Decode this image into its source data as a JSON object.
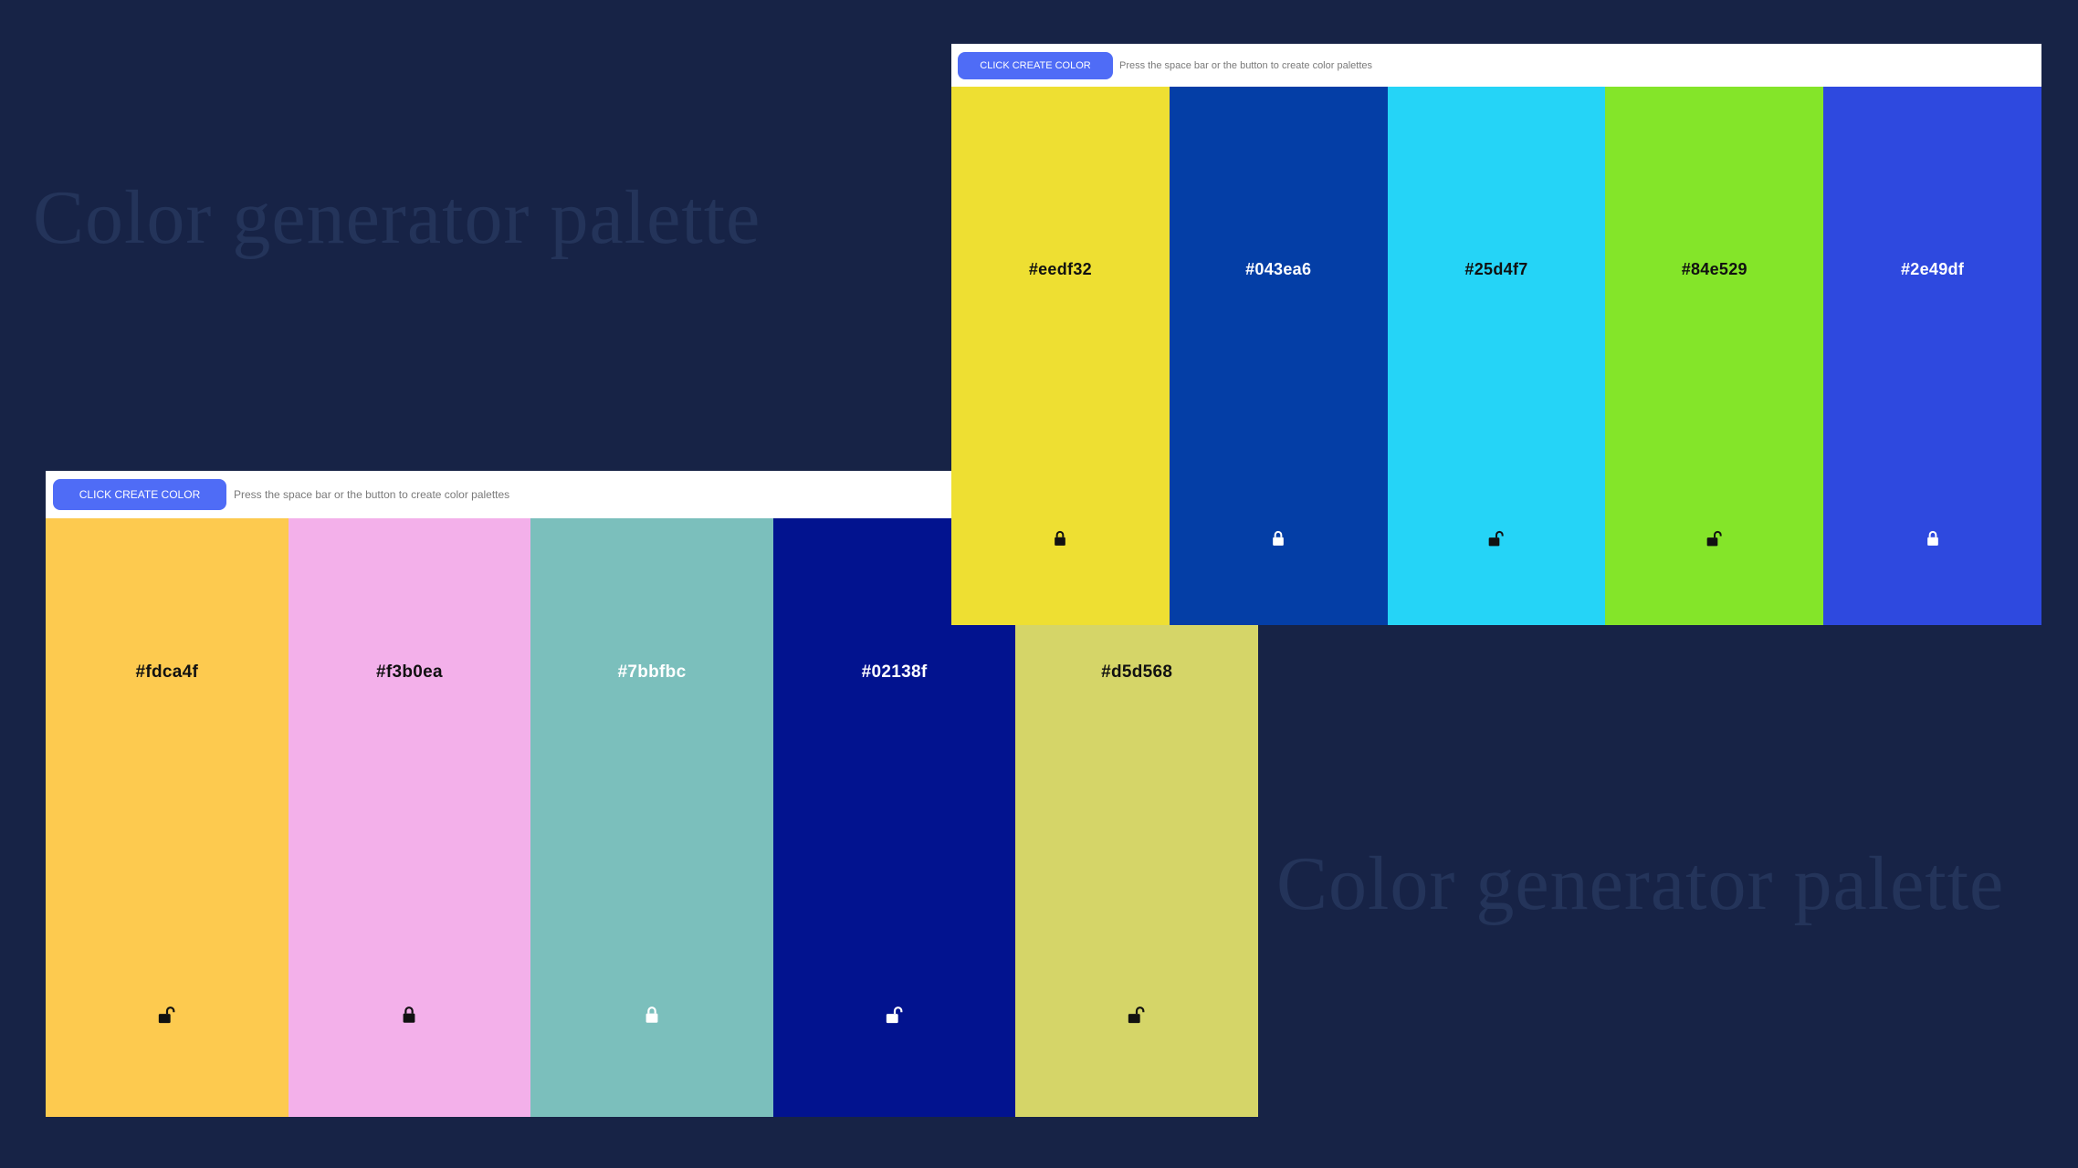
{
  "background_titles": {
    "left": "Color generator palette",
    "right": "Color generator palette"
  },
  "screenshots": [
    {
      "button_label": "CLICK CREATE COLOR",
      "hint": "Press the space bar or the button to create color palettes",
      "colors": [
        {
          "hex": "#fdca4f",
          "swatch": "#fdca4f",
          "text_color": "dark",
          "lock_state": "unlocked",
          "icon": "lock-open-icon"
        },
        {
          "hex": "#f3b0ea",
          "swatch": "#f3b0ea",
          "text_color": "dark",
          "lock_state": "locked",
          "icon": "lock-closed-icon"
        },
        {
          "hex": "#7bbfbc",
          "swatch": "#7bbfbc",
          "text_color": "light",
          "lock_state": "locked",
          "icon": "lock-closed-icon"
        },
        {
          "hex": "#02138f",
          "swatch": "#02138f",
          "text_color": "light",
          "lock_state": "unlocked",
          "icon": "lock-open-icon"
        },
        {
          "hex": "#d5d568",
          "swatch": "#d5d568",
          "text_color": "dark",
          "lock_state": "unlocked",
          "icon": "lock-open-icon"
        }
      ]
    },
    {
      "button_label": "CLICK CREATE COLOR",
      "hint": "Press the space bar or the button to create color palettes",
      "colors": [
        {
          "hex": "#eedf32",
          "swatch": "#eedf32",
          "text_color": "dark",
          "lock_state": "locked",
          "icon": "lock-closed-icon"
        },
        {
          "hex": "#043ea6",
          "swatch": "#043ea6",
          "text_color": "light",
          "lock_state": "locked",
          "icon": "lock-closed-icon"
        },
        {
          "hex": "#25d4f7",
          "swatch": "#25d4f7",
          "text_color": "dark",
          "lock_state": "unlocked",
          "icon": "lock-open-icon"
        },
        {
          "hex": "#84e529",
          "swatch": "#84e529",
          "text_color": "dark",
          "lock_state": "unlocked",
          "icon": "lock-open-icon"
        },
        {
          "hex": "#2e49df",
          "swatch": "#2e49df",
          "text_color": "light",
          "lock_state": "locked",
          "icon": "lock-closed-icon"
        }
      ]
    }
  ],
  "colors": {
    "page_background": "#172346",
    "background_title": "#24345a",
    "button": "#4f6cf6",
    "button_text": "#ffffff",
    "hint_text": "#7a7a7a",
    "dark_text": "#111111",
    "light_text": "#ffffff"
  }
}
